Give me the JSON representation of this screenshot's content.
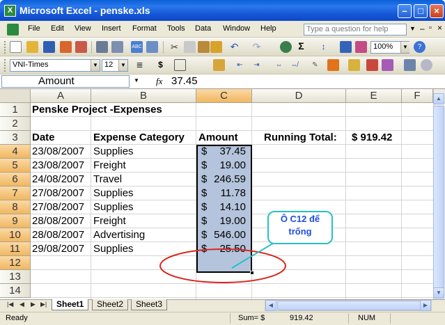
{
  "window": {
    "title": "Microsoft Excel - penske.xls",
    "app_icon_text": "X",
    "min": "–",
    "max": "□",
    "close": "×"
  },
  "menu": [
    "File",
    "Edit",
    "View",
    "Insert",
    "Format",
    "Tools",
    "Data",
    "Window",
    "Help"
  ],
  "help_search_placeholder": "Type a question for help",
  "toolbar": {
    "zoom": "100%",
    "font": "VNI-Times",
    "font_size": "12",
    "currency": "$",
    "sigma": "Σ"
  },
  "formula_bar": {
    "name_box": "Amount",
    "fx": "fx",
    "value": "37.45"
  },
  "columns": [
    "A",
    "B",
    "C",
    "D",
    "E",
    "F"
  ],
  "rows": [
    "1",
    "2",
    "3",
    "4",
    "5",
    "6",
    "7",
    "8",
    "9",
    "10",
    "11",
    "12",
    "13",
    "14"
  ],
  "sheet": {
    "title": "Penske Project -Expenses",
    "headers": {
      "date": "Date",
      "category": "Expense Category",
      "amount": "Amount",
      "running_label": "Running Total:",
      "running_value": "$ 919.42"
    },
    "data": [
      {
        "date": "23/08/2007",
        "category": "Supplies",
        "sym": "$",
        "amount": "37.45"
      },
      {
        "date": "23/08/2007",
        "category": "Freight",
        "sym": "$",
        "amount": "19.00"
      },
      {
        "date": "24/08/2007",
        "category": "Travel",
        "sym": "$",
        "amount": "246.59"
      },
      {
        "date": "27/08/2007",
        "category": "Supplies",
        "sym": "$",
        "amount": "11.78"
      },
      {
        "date": "27/08/2007",
        "category": "Supplies",
        "sym": "$",
        "amount": "14.10"
      },
      {
        "date": "28/08/2007",
        "category": "Freight",
        "sym": "$",
        "amount": "19.00"
      },
      {
        "date": "28/08/2007",
        "category": "Advertising",
        "sym": "$",
        "amount": "546.00"
      },
      {
        "date": "29/08/2007",
        "category": "Supplies",
        "sym": "$",
        "amount": "25.50"
      }
    ]
  },
  "annotation": {
    "line1": "Ô C12 để",
    "line2": "trống"
  },
  "tabs": {
    "nav": "|◀ ◀ ▶ ▶|",
    "sheets": [
      "Sheet1",
      "Sheet2",
      "Sheet3"
    ]
  },
  "status": {
    "ready": "Ready",
    "sum_label": "Sum= $",
    "sum_value": "919.42",
    "num": "NUM"
  },
  "colors": {
    "accent_title": "#0a5fd8",
    "selection": "#b4c4dc",
    "header_selected": "#f1b761",
    "callout_border": "#28c0c4",
    "callout_text": "#1f4fe0",
    "ellipse": "#d9251d"
  }
}
